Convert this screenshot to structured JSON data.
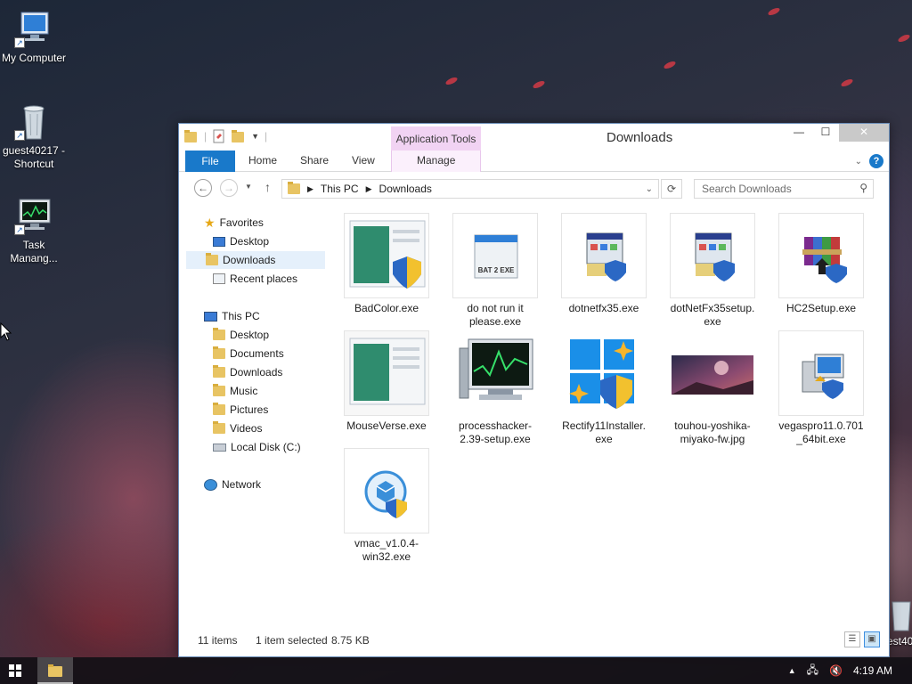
{
  "desktop": {
    "icons": [
      {
        "label": "My Computer",
        "icon": "computer-icon"
      },
      {
        "label": "guest40217 - Shortcut",
        "icon": "recycle-bin-icon"
      },
      {
        "label": "Task Manang...",
        "icon": "task-manager-icon"
      }
    ],
    "edge_icon_label": "est40"
  },
  "window": {
    "title": "Downloads",
    "contextual_tab_group": "Application Tools",
    "ribbon_tabs": {
      "file": "File",
      "home": "Home",
      "share": "Share",
      "view": "View",
      "manage": "Manage"
    },
    "help_label": "?",
    "address": {
      "root": "This PC",
      "current": "Downloads"
    },
    "search_placeholder": "Search Downloads"
  },
  "nav_pane": {
    "favorites": {
      "label": "Favorites",
      "items": [
        "Desktop",
        "Downloads",
        "Recent places"
      ]
    },
    "this_pc": {
      "label": "This PC",
      "items": [
        "Desktop",
        "Documents",
        "Downloads",
        "Music",
        "Pictures",
        "Videos",
        "Local Disk (C:)"
      ]
    },
    "network": {
      "label": "Network"
    },
    "selected": "Downloads"
  },
  "files": [
    {
      "name": "BadColor.exe",
      "icon": "app-shield-icon"
    },
    {
      "name": "do not run it please.exe",
      "icon": "bat-to-exe-icon",
      "thumb_text": "BAT 2 EXE"
    },
    {
      "name": "dotnetfx35.exe",
      "icon": "installer-icon"
    },
    {
      "name": "dotNetFx35setup.exe",
      "icon": "installer-icon"
    },
    {
      "name": "HC2Setup.exe",
      "icon": "winrar-installer-icon"
    },
    {
      "name": "MouseVerse.exe",
      "icon": "app-window-icon"
    },
    {
      "name": "processhacker-2.39-setup.exe",
      "icon": "monitor-icon"
    },
    {
      "name": "Rectify11Installer.exe",
      "icon": "windows-shield-icon"
    },
    {
      "name": "touhou-yoshika-miyako-fw.jpg",
      "icon": "image-icon"
    },
    {
      "name": "vegaspro11.0.701_64bit.exe",
      "icon": "setup-computer-icon"
    },
    {
      "name": "vmac_v1.0.4-win32.exe",
      "icon": "box-shield-icon"
    }
  ],
  "selected_file": "MouseVerse.exe",
  "status": {
    "item_count": "11 items",
    "selection": "1 item selected",
    "size": "8.75 KB"
  },
  "taskbar": {
    "clock": "4:19 AM"
  },
  "colors": {
    "ribbon_file": "#1979ca",
    "contextual_tab": "#f1d3f3",
    "selection": "#e5f0fb"
  }
}
